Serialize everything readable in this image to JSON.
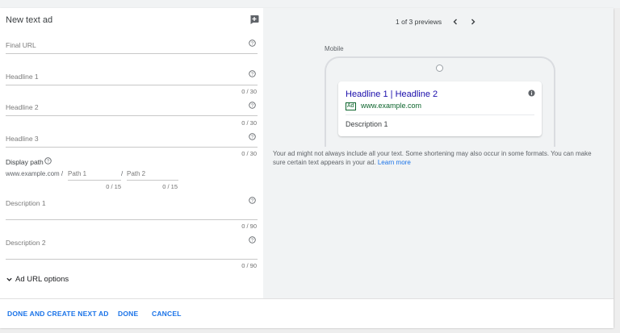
{
  "editor": {
    "title": "New text ad",
    "final_url_label": "Final URL",
    "headline1_label": "Headline 1",
    "headline1_counter": "0 / 30",
    "headline2_label": "Headline 2",
    "headline2_counter": "0 / 30",
    "headline3_label": "Headline 3",
    "headline3_counter": "0 / 30",
    "display_path_label": "Display path",
    "display_path_base": "www.example.com /",
    "path1_placeholder": "Path 1",
    "path2_prefix": "/",
    "path2_placeholder": "Path 2",
    "path1_counter": "0 / 15",
    "path2_counter": "0 / 15",
    "description1_label": "Description 1",
    "description1_counter": "0 / 90",
    "description2_label": "Description 2",
    "description2_counter": "0 / 90",
    "ad_url_options_label": "Ad URL options"
  },
  "preview": {
    "counter": "1 of 3 previews",
    "device_label": "Mobile",
    "headline": "Headline 1 | Headline 2",
    "badge": "Ad",
    "url": "www.example.com",
    "description": "Description 1",
    "disclaimer": "Your ad might not always include all your text. Some shortening may also occur in some formats. You can make sure certain text appears in your ad.",
    "learn_more": "Learn more"
  },
  "footer": {
    "done_and_next": "DONE AND CREATE NEXT AD",
    "done": "DONE",
    "cancel": "CANCEL"
  },
  "colors": {
    "accent": "#1a73e8",
    "ad_headline": "#1a0dab",
    "ad_url": "#0d652d"
  },
  "icons": [
    "add-ad-icon",
    "help-icon",
    "chevron-left-icon",
    "chevron-right-icon",
    "info-icon",
    "chevron-down-icon"
  ]
}
